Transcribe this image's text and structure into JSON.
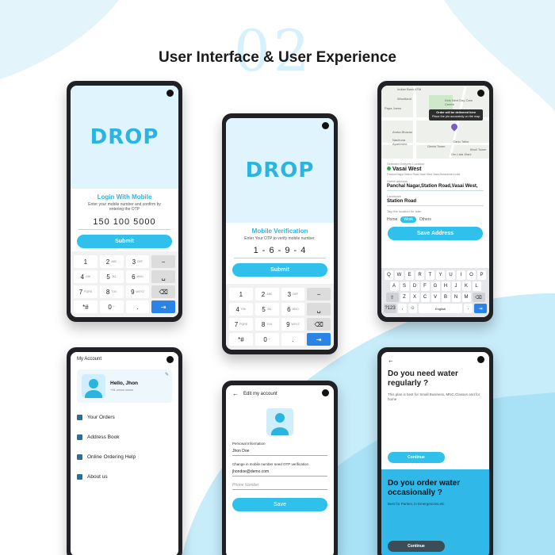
{
  "page": {
    "title": "User Interface & User Experience",
    "deco_number": "02"
  },
  "colors": {
    "accent": "#2fc0ec",
    "dark": "#1f2124",
    "blue_key": "#2a84e8"
  },
  "login_screen": {
    "logo": "DROP",
    "heading": "Login With Mobile",
    "sub": "Enter your mobile number and confirm by entering the OTP",
    "phone_value": "150 100 5000",
    "submit_label": "Submit"
  },
  "verify_screen": {
    "logo": "DROP",
    "heading": "Mobile Verification",
    "sub": "Enter Your OTP to verify mobile number.",
    "otp_value": "1 - 6 - 9 - 4",
    "submit_label": "Submit"
  },
  "keypad": {
    "keys": [
      {
        "main": "1",
        "sub": ""
      },
      {
        "main": "2",
        "sub": "ABC"
      },
      {
        "main": "3",
        "sub": "DEF"
      },
      {
        "main": "−",
        "sub": ""
      },
      {
        "main": "4",
        "sub": "GHI"
      },
      {
        "main": "5",
        "sub": "JKL"
      },
      {
        "main": "6",
        "sub": "MNO"
      },
      {
        "main": "␣",
        "sub": ""
      },
      {
        "main": "7",
        "sub": "PQRS"
      },
      {
        "main": "8",
        "sub": "TUV"
      },
      {
        "main": "9",
        "sub": "WXYZ"
      },
      {
        "main": "⌫",
        "sub": ""
      },
      {
        "main": "*#",
        "sub": ""
      },
      {
        "main": "0",
        "sub": "+"
      },
      {
        "main": ".",
        "sub": ""
      },
      {
        "main": "⇥",
        "sub": ""
      }
    ]
  },
  "map_screen": {
    "tooltip_line1": "Order will be delivered here",
    "tooltip_line2": "Place the pin accurately on the map",
    "map_labels": [
      "Indian Bank ATM",
      "Woodland",
      "Papa Joens",
      "Kids Next Day Care Centre",
      "Amba Bhavan",
      "Nachuna Apartment",
      "Geeta Tower",
      "Ganu Tailor",
      "Bhoil Tower",
      "Om Lala Jilani"
    ],
    "selected_label": "Selected Delivery Location",
    "location_name": "Vasai West",
    "location_detail": "Panchal Nagar,Station Road,Vasai West,Vasai,Maharashtra,India",
    "street_label": "Street address",
    "street_value": "Panchal Nagar,Station Road,Vasai West,",
    "landmark_label": "Landmark",
    "landmark_value": "Station Road",
    "tag_label": "Tag this location for later",
    "tags": [
      "Home",
      "Work",
      "Others"
    ],
    "save_label": "Save Address",
    "kb_rows": [
      [
        "Q",
        "W",
        "E",
        "R",
        "T",
        "Y",
        "U",
        "I",
        "O",
        "P"
      ],
      [
        "A",
        "S",
        "D",
        "F",
        "G",
        "H",
        "J",
        "K",
        "L"
      ],
      [
        "⇧",
        "Z",
        "X",
        "C",
        "V",
        "B",
        "N",
        "M",
        "⌫"
      ]
    ],
    "kb_bottom": [
      "?123",
      ",",
      "☺",
      "English",
      ".",
      "⇥"
    ]
  },
  "account_screen": {
    "header": "My Account",
    "name": "Hello, Jhon",
    "phone": "+91 xxxxx xxxxx",
    "menu": [
      "Your Orders",
      "Address Book",
      "Online Ordering Help",
      "About us"
    ]
  },
  "edit_screen": {
    "header": "Edit my account",
    "personal_label": "Personal Information",
    "name_value": "Jhon Doe",
    "change_label": "Change in mobile number need OTP verification",
    "email_value": "jhondoe@demo.com",
    "phone_placeholder": "Phone Number",
    "save_label": "Save"
  },
  "plans_screen": {
    "plan1_title": "Do you need water regularly ?",
    "plan1_desc": "This plan is best for Small Business, MNC,Classes and for home",
    "plan1_btn": "Continue",
    "plan2_title": "Do you order water occasionally ?",
    "plan2_desc": "Best for Parties, in Emergencies,etc",
    "plan2_btn": "Continue"
  }
}
